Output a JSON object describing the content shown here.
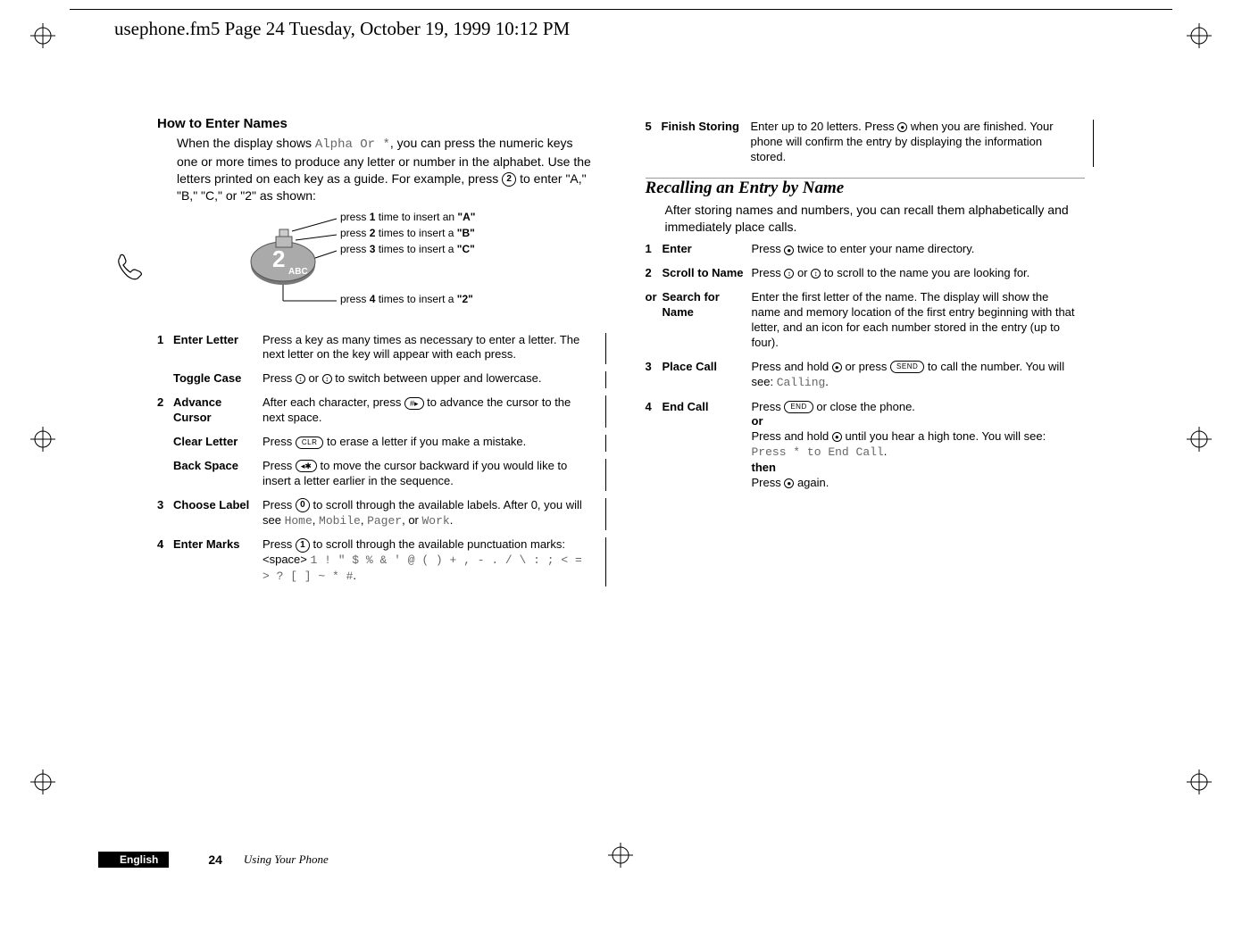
{
  "header": "usephone.fm5  Page 24  Tuesday, October 19, 1999  10:12 PM",
  "footer": {
    "lang": "English",
    "page_num": "24",
    "page_title": "Using Your Phone"
  },
  "left": {
    "heading": "How to Enter Names",
    "intro_parts": [
      "When the display shows ",
      "Alpha Or *",
      ", you can press the numeric keys one or more times to produce any letter or number in the alphabet. Use the letters printed on each key as a guide. For example, press ",
      "2",
      " to enter \"A,\" \"B,\" \"C,\" or \"2\" as shown:"
    ],
    "keyfig": {
      "key_label": "2",
      "key_sub": "ABC",
      "lines": [
        {
          "pre": "press ",
          "bold": "1",
          "mid": " time to insert an ",
          "q": "\"A\""
        },
        {
          "pre": "press ",
          "bold": "2",
          "mid": " times to insert a ",
          "q": "\"B\""
        },
        {
          "pre": "press ",
          "bold": "3",
          "mid": " times to insert a ",
          "q": "\"C\""
        },
        {
          "pre": "press ",
          "bold": "4",
          "mid": " times to insert a ",
          "q": "\"2\""
        }
      ]
    },
    "steps": [
      {
        "num": "1",
        "label": "Enter Letter",
        "desc": "Press a key as many times as necessary to enter a letter. The next letter on the key will appear with each press."
      },
      {
        "num": "",
        "label": "Toggle Case",
        "desc_parts": [
          "Press ",
          "↕",
          " or ",
          "↕",
          " to switch between upper and lowercase."
        ]
      },
      {
        "num": "2",
        "label": "Advance Cursor",
        "desc_parts": [
          "After each character, press ",
          "#▸",
          " to advance the cursor to the next space."
        ]
      },
      {
        "num": "",
        "label": "Clear Letter",
        "desc_parts": [
          "Press ",
          "CLR",
          " to erase a letter if you make a mistake."
        ]
      },
      {
        "num": "",
        "label": "Back Space",
        "desc_parts": [
          "Press ",
          "◂✱",
          " to move the cursor backward if you would like to insert a letter earlier in the sequence."
        ]
      },
      {
        "num": "3",
        "label": "Choose Label",
        "desc_parts": [
          "Press ",
          "0",
          " to scroll through the available labels. After 0, you will see ",
          "Home",
          ", ",
          "Mobile",
          ", ",
          "Pager",
          ", or ",
          "Work",
          "."
        ]
      },
      {
        "num": "4",
        "label": "Enter Marks",
        "desc_parts": [
          "Press ",
          "1",
          " to scroll through the available punctuation marks: <space>  ",
          "1 ! \" $ % & ' @ ( ) + , - . / \\ : ; < = > ? [ ] ~ * #",
          "."
        ]
      }
    ]
  },
  "right": {
    "step5": {
      "num": "5",
      "label": "Finish Storing",
      "desc_parts": [
        "Enter up to 20 letters. Press ",
        "●",
        " when you are finished. Your phone will confirm the entry by displaying the information stored."
      ]
    },
    "heading": "Recalling an Entry by Name",
    "intro": "After storing names and numbers, you can recall them alphabetically and immediately place calls.",
    "steps": [
      {
        "num": "1",
        "label": "Enter",
        "desc_parts": [
          "Press ",
          "●",
          " twice to enter your name directory."
        ]
      },
      {
        "num": "2",
        "label": "Scroll to Name",
        "desc_parts": [
          "Press ",
          "↕",
          " or ",
          "↕",
          " to scroll to the name you are looking for."
        ]
      },
      {
        "num": "or",
        "label": "Search for Name",
        "desc": "Enter the first letter of the name. The display will show the name and memory location of the first entry beginning with that letter, and an icon for each number stored in the entry (up to four)."
      },
      {
        "num": "3",
        "label": "Place Call",
        "desc_parts": [
          "Press and hold ",
          "●",
          " or press ",
          "SEND",
          " to call the number. You will see: ",
          "Calling",
          "."
        ]
      },
      {
        "num": "4",
        "label": "End Call",
        "desc_parts": [
          "Press ",
          "END",
          " or close the phone.",
          "\n",
          "or",
          "\n",
          "Press and hold ",
          "●",
          " until you hear a high tone. You will see: ",
          "Press * to End Call",
          ".",
          "\n",
          "then",
          "\n",
          "Press ",
          "●",
          " again."
        ]
      }
    ]
  }
}
